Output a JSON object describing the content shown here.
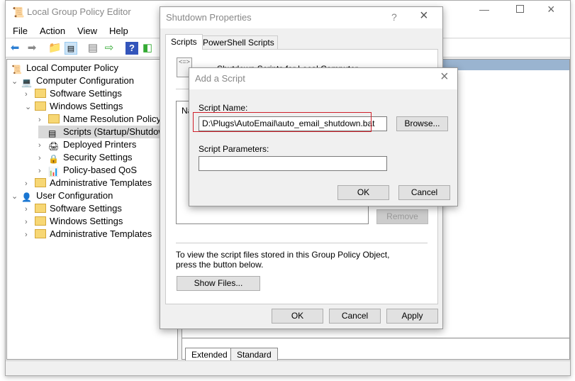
{
  "main_window": {
    "title": "Local Group Policy Editor",
    "menu": [
      "File",
      "Action",
      "View",
      "Help"
    ],
    "toolbar_icons": [
      "back-icon",
      "forward-icon",
      "up-folder-icon",
      "show-hide-tree-icon",
      "properties-icon",
      "export-list-icon",
      "help-icon",
      "show-action-pane-icon"
    ],
    "tree": [
      {
        "label": "Local Computer Policy",
        "level": 0,
        "expander": "",
        "icon": "policy-icon"
      },
      {
        "label": "Computer Configuration",
        "level": 0,
        "expander": "open",
        "icon": "computer-icon"
      },
      {
        "label": "Software Settings",
        "level": 1,
        "expander": "closed",
        "icon": "folder-icon"
      },
      {
        "label": "Windows Settings",
        "level": 1,
        "expander": "open",
        "icon": "folder-icon"
      },
      {
        "label": "Name Resolution Policy",
        "level": 2,
        "expander": "closed",
        "icon": "folder-icon"
      },
      {
        "label": "Scripts (Startup/Shutdown)",
        "level": 2,
        "expander": "",
        "icon": "script-icon",
        "selected": true
      },
      {
        "label": "Deployed Printers",
        "level": 2,
        "expander": "closed",
        "icon": "printer-icon"
      },
      {
        "label": "Security Settings",
        "level": 2,
        "expander": "closed",
        "icon": "security-icon"
      },
      {
        "label": "Policy-based QoS",
        "level": 2,
        "expander": "closed",
        "icon": "qos-chart-icon"
      },
      {
        "label": "Administrative Templates",
        "level": 1,
        "expander": "closed",
        "icon": "folder-icon"
      },
      {
        "label": "User Configuration",
        "level": 0,
        "expander": "open",
        "icon": "user-icon"
      },
      {
        "label": "Software Settings",
        "level": 1,
        "expander": "closed",
        "icon": "folder-icon"
      },
      {
        "label": "Windows Settings",
        "level": 1,
        "expander": "closed",
        "icon": "folder-icon"
      },
      {
        "label": "Administrative Templates",
        "level": 1,
        "expander": "closed",
        "icon": "folder-icon"
      }
    ],
    "bottom_tabs": [
      "Extended",
      "Standard"
    ],
    "header_highlight_color": "#9ab4d0"
  },
  "shutdown_dialog": {
    "title": "Shutdown Properties",
    "help": "?",
    "tabs": [
      "Scripts",
      "PowerShell Scripts"
    ],
    "heading": "Shutdown Scripts for Local Computer",
    "list_header_partial": "Na",
    "remove_label": "Remove",
    "info_text": "To view the script files stored in this Group Policy Object, press the button below.",
    "show_files_label": "Show Files...",
    "ok_label": "OK",
    "cancel_label": "Cancel",
    "apply_label": "Apply"
  },
  "add_script_dialog": {
    "title": "Add a Script",
    "script_name_label": "Script Name:",
    "script_name_value": "D:\\Plugs\\AutoEmail\\auto_email_shutdown.bat",
    "browse_label": "Browse...",
    "script_params_label": "Script Parameters:",
    "script_params_value": "",
    "ok_label": "OK",
    "cancel_label": "Cancel",
    "highlight_color": "#d0202a"
  }
}
